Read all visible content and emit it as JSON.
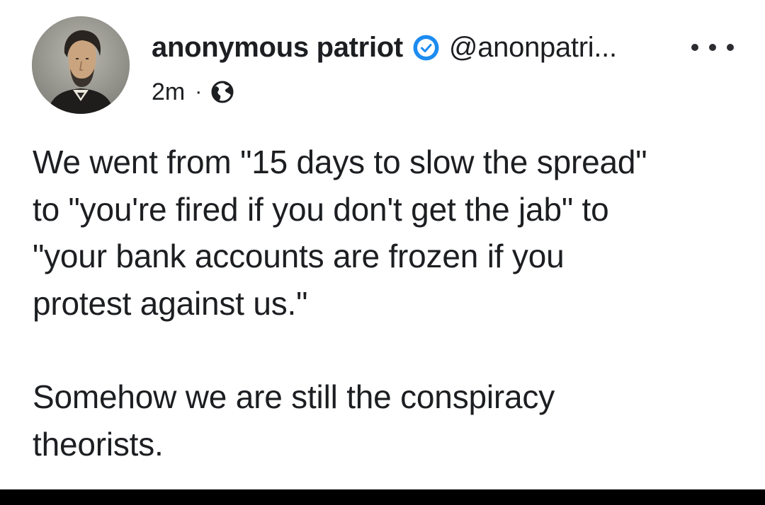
{
  "post": {
    "author": {
      "name": "anonymous patriot",
      "handle": "@anonpatri...",
      "verified": true,
      "verified_icon": "verified-check-icon",
      "avatar": "avatar-portrait"
    },
    "timestamp": "2m",
    "separator": "·",
    "audience_icon": "globe-icon",
    "more_icon": "more-horizontal-icon",
    "body": {
      "paragraph_1": "We went from \"15 days to slow the spread\"\nto \"you're fired if you don't get the jab\" to\n\"your bank accounts are frozen if you\nprotest against us.\"",
      "paragraph_2": "Somehow we are still the conspiracy\ntheorists."
    }
  },
  "colors": {
    "text": "#1c1e21",
    "verified_badge": "#1d8cf0",
    "background": "#ffffff",
    "bottom_bar": "#000000"
  }
}
